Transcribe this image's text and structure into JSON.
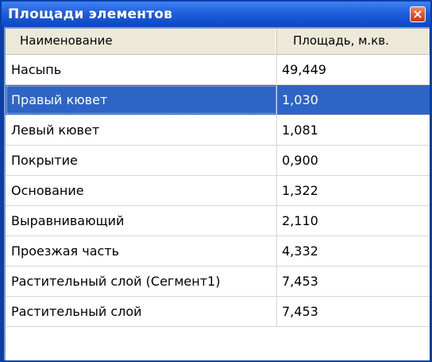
{
  "window": {
    "title": "Площади элементов"
  },
  "table": {
    "columns": [
      "Наименование",
      "Площадь, м.кв."
    ],
    "rows": [
      {
        "name": "Насыпь",
        "area": "49,449"
      },
      {
        "name": "Правый кювет",
        "area": "1,030"
      },
      {
        "name": "Левый кювет",
        "area": "1,081"
      },
      {
        "name": "Покрытие",
        "area": "0,900"
      },
      {
        "name": "Основание",
        "area": "1,322"
      },
      {
        "name": "Выравнивающий",
        "area": "2,110"
      },
      {
        "name": "Проезжая часть",
        "area": "4,332"
      },
      {
        "name": "Растительный слой (Сегмент1)",
        "area": "7,453"
      },
      {
        "name": "Растительный слой",
        "area": "7,453"
      }
    ],
    "selected_index": 1
  },
  "icons": {
    "close": "close-icon"
  },
  "colors": {
    "titlebar": "#1f5fdb",
    "selection": "#2f64c7",
    "close_button": "#d9512c"
  }
}
